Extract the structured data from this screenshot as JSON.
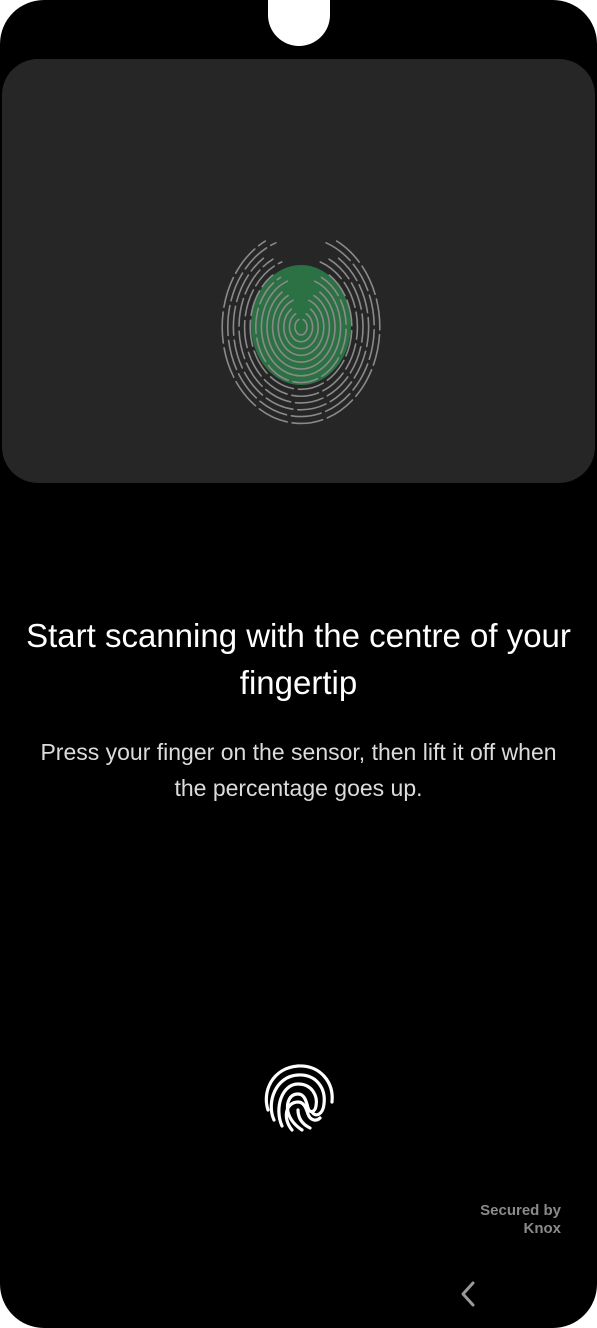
{
  "enrollment": {
    "heading": "Start scanning with the centre of your fingertip",
    "description": "Press your finger on the sensor, then lift it off when the percentage goes up."
  },
  "branding": {
    "secured_by": "Secured by",
    "knox": "Knox"
  },
  "icons": {
    "illustration": "fingerprint-illustration",
    "sensor": "fingerprint-icon",
    "back": "chevron-left-icon"
  },
  "colors": {
    "background": "#000000",
    "card": "#262626",
    "highlight": "#2e8b4f",
    "ridge": "#7a7a7a"
  }
}
